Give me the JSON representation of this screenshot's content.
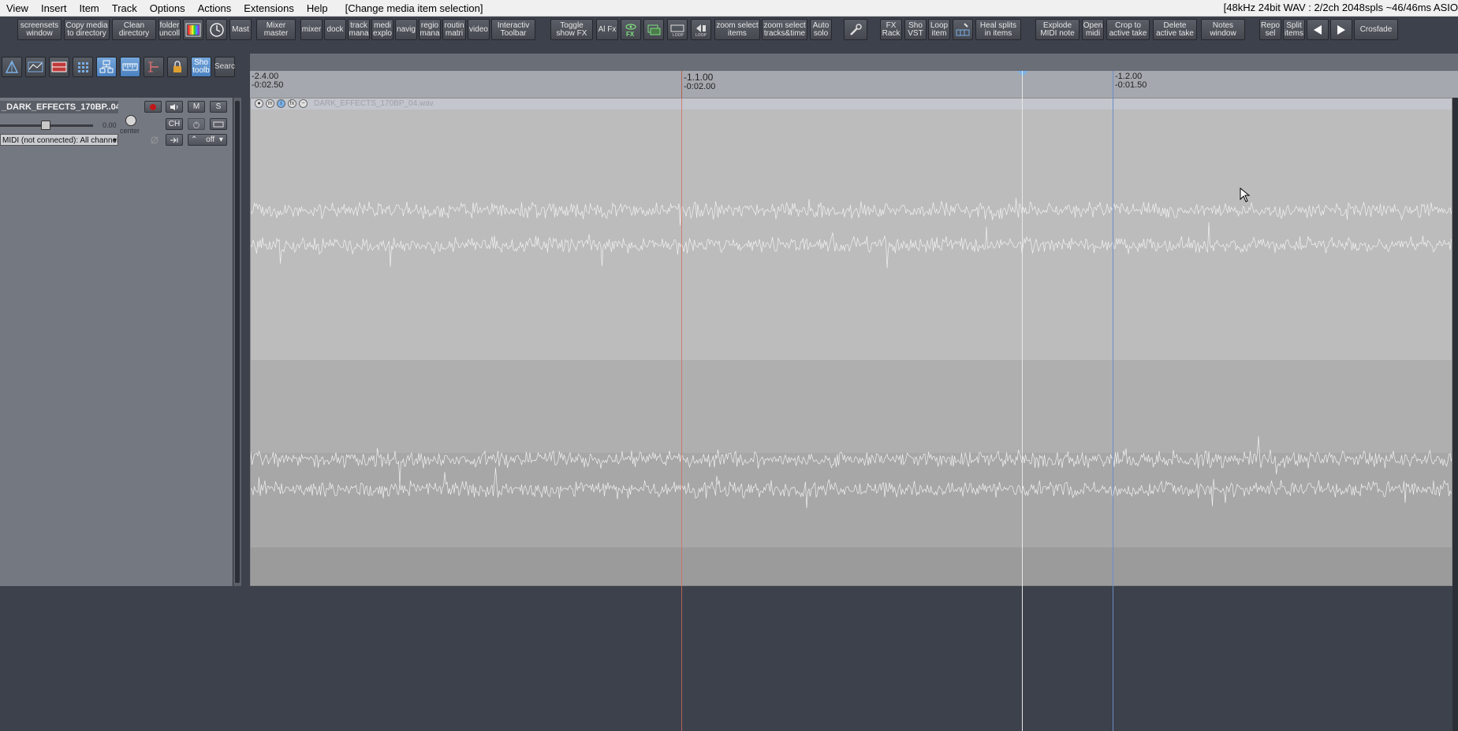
{
  "menu": {
    "items": [
      "View",
      "Insert",
      "Item",
      "Track",
      "Options",
      "Actions",
      "Extensions",
      "Help"
    ],
    "status": "[Change media item selection]",
    "right_info": "[48kHz 24bit WAV : 2/2ch 2048spls ~46/46ms ASIO"
  },
  "toolbar": {
    "screensets": "screensets\nwindow",
    "copy_media": "Copy media\nto directory",
    "clean_dir": "Clean\ndirectory",
    "folder": "folder\nuncoll",
    "mast": "Mast",
    "mixer_master": "Mixer\nmaster",
    "mixer": "mixer",
    "dock": "dock",
    "track_mana": "track\nmana",
    "medi_explo": "medi\nexplo",
    "navig": "navig",
    "regio_mana": "regio\nmana",
    "routin_matri": "routin\nmatri",
    "video": "video",
    "interactiv": "Interactiv\nToolbar",
    "toggle_fx": "Toggle\nshow FX",
    "al_fx": "Al Fx",
    "fx_icon": "FX",
    "loop1": "LOOP",
    "loop2": "LOOP",
    "zoom_items": "zoom select\nitems",
    "zoom_tracks": "zoom select\ntracks&time",
    "auto_solo": "Auto\nsolo",
    "fx_rack": "FX\nRack",
    "sho_vst": "Sho\nVST",
    "loop_item": "Loop\nitem",
    "heal": "Heal splits\nin items",
    "explode": "Explode\nMIDI note",
    "open_midi": "Open\nmidi",
    "crop": "Crop to\nactive take",
    "delete_take": "Delete\nactive take",
    "notes": "Notes\nwindow",
    "repo_sel": "Repo\nsel",
    "split_items": "Split\nitems",
    "crossfade": "Crosfade"
  },
  "toolbar2": {
    "show_toolbar": "Sho\ntoolb",
    "search": "Searc"
  },
  "ruler": {
    "m1_top": "-2.4.00",
    "m1_bot": "-0:02.50",
    "m2_top": "-1.1.00",
    "m2_bot": "-0:02.00",
    "m3_top": "-1.2.00",
    "m3_bot": "-0:01.50"
  },
  "track": {
    "name": "_DARK_EFFECTS_170BP..04",
    "m": "M",
    "s": "S",
    "volume": "0.00",
    "pan": "center",
    "midi_input": "MIDI (not connected): All channel",
    "automation": "off",
    "ch": "CH",
    "fader_level": 0.44
  },
  "item": {
    "title": "DARK_EFFECTS_170BP_04.wav"
  },
  "colors": {
    "accent": "#4a80bf",
    "toolbar_bg": "#3d414b",
    "waveform": "#f2f2f2",
    "edit_cursor": "#d56a5c",
    "play_cursor": "#e8e8e8"
  }
}
